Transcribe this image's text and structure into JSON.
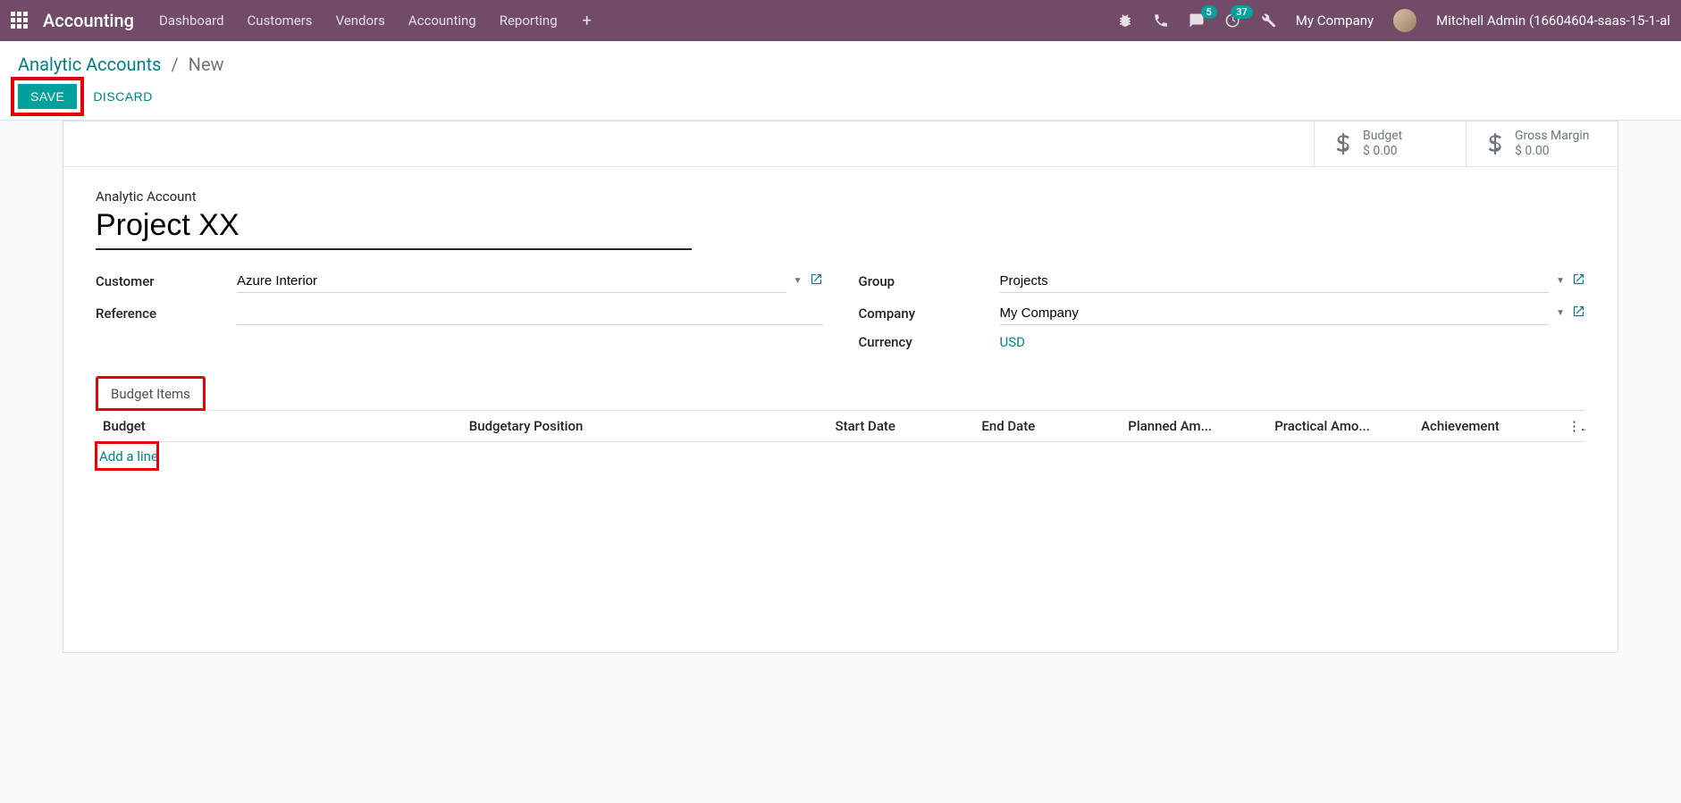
{
  "nav": {
    "brand": "Accounting",
    "links": [
      "Dashboard",
      "Customers",
      "Vendors",
      "Accounting",
      "Reporting"
    ],
    "messages_badge": "5",
    "activities_badge": "37",
    "company": "My Company",
    "user": "Mitchell Admin (16604604-saas-15-1-al"
  },
  "breadcrumb": {
    "parent": "Analytic Accounts",
    "current": "New"
  },
  "buttons": {
    "save": "SAVE",
    "discard": "DISCARD"
  },
  "stats": {
    "budget_label": "Budget",
    "budget_value": "$ 0.00",
    "margin_label": "Gross Margin",
    "margin_value": "$ 0.00"
  },
  "form": {
    "title_label": "Analytic Account",
    "title_value": "Project XX",
    "customer_label": "Customer",
    "customer_value": "Azure Interior",
    "reference_label": "Reference",
    "reference_value": "",
    "group_label": "Group",
    "group_value": "Projects",
    "company_label": "Company",
    "company_value": "My Company",
    "currency_label": "Currency",
    "currency_value": "USD"
  },
  "tabs": {
    "budget_items": "Budget Items"
  },
  "table": {
    "columns": [
      "Budget",
      "Budgetary Position",
      "Start Date",
      "End Date",
      "Planned Am...",
      "Practical Amo...",
      "Achievement"
    ],
    "add_line": "Add a line"
  }
}
